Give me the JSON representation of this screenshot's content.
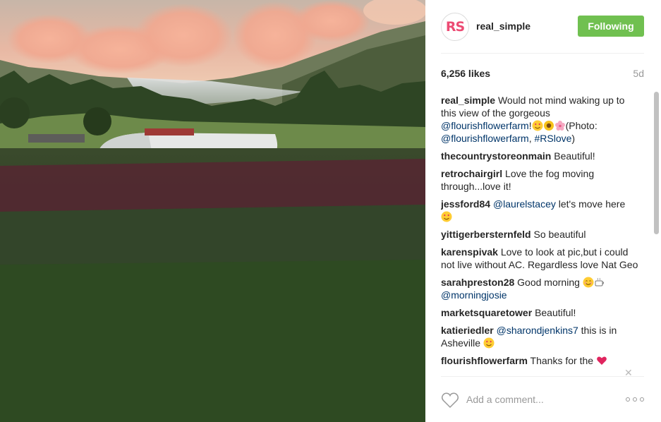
{
  "post": {
    "username": "real_simple",
    "avatar_text": "RS",
    "follow_label": "Following",
    "likes": "6,256 likes",
    "age": "5d",
    "photo_alt": "Flower farm with fog over mountains"
  },
  "caption": {
    "user": "real_simple",
    "text_1": "Would not mind waking up to this view of the gorgeous",
    "mention_1": "@flourishflowerfarm",
    "text_2": "!",
    "text_3": "(Photo:",
    "mention_2": "@flourishflowerfarm",
    "text_4": ",",
    "hashtag": "#RSlove",
    "text_5": ")"
  },
  "comments": [
    {
      "user": "thecountrystoreonmain",
      "text": "Beautiful!"
    },
    {
      "user": "retrochairgirl",
      "text": "Love the fog moving through...love it!"
    },
    {
      "user": "jessford84",
      "mention": "@laurelstacey",
      "text": "let's move here"
    },
    {
      "user": "yittigerbersternfeld",
      "text": "So beautiful"
    },
    {
      "user": "karenspivak",
      "text": "Love to look at pic,but i could not live without AC. Regardless love Nat Geo"
    },
    {
      "user": "sarahpreston28",
      "text": "Good morning",
      "mention": "@morningjosie"
    },
    {
      "user": "marketsquaretower",
      "text": "Beautiful!"
    },
    {
      "user": "katieriedler",
      "mention": "@sharondjenkins7",
      "text": "this is in Asheville"
    },
    {
      "user": "flourishflowerfarm",
      "text": "Thanks for the"
    }
  ],
  "footer": {
    "comment_placeholder": "Add a comment...",
    "like_icon": "heart-outline-icon",
    "more_icon": "more-options-icon"
  },
  "colors": {
    "follow_button": "#70c050",
    "mention": "#003569",
    "avatar_text": "#ec4b73"
  }
}
